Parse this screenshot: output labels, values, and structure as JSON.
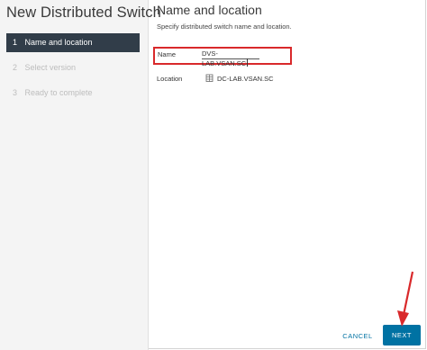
{
  "wizard": {
    "title": "New Distributed Switch",
    "steps": [
      {
        "number": "1",
        "label": "Name and location",
        "active": true
      },
      {
        "number": "2",
        "label": "Select version",
        "active": false
      },
      {
        "number": "3",
        "label": "Ready to complete",
        "active": false
      }
    ]
  },
  "page": {
    "title": "Name and location",
    "description": "Specify distributed switch name and location.",
    "name_label": "Name",
    "name_value": "DVS-LAB.VSAN.SC",
    "location_label": "Location",
    "location_icon": "datacenter-icon",
    "location_value": "DC-LAB.VSAN.SC"
  },
  "footer": {
    "cancel_label": "CANCEL",
    "next_label": "NEXT"
  },
  "colors": {
    "highlight": "#d9292b",
    "active_step": "#313d49",
    "primary": "#0072a3"
  }
}
